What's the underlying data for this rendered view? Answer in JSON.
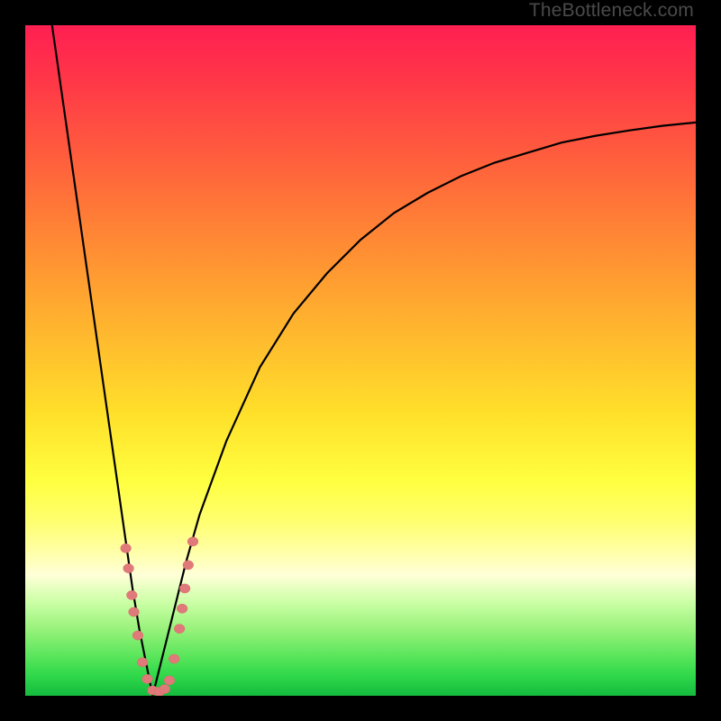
{
  "watermark": "TheBottleneck.com",
  "colors": {
    "frame": "#000000",
    "curve": "#000000",
    "dot_fill": "#e07a7a",
    "dot_stroke": "#d86a6a"
  },
  "chart_data": {
    "type": "line",
    "title": "",
    "xlabel": "",
    "ylabel": "",
    "xlim": [
      0,
      100
    ],
    "ylim": [
      0,
      100
    ],
    "note": "Background gradient encodes value: red=high, green=low. Two curves (left steep descent, right asymptotic rise) meeting at a notch near x≈19, y≈0. Pink dots mark sample points on both curve branches near the notch.",
    "series": [
      {
        "name": "left-branch",
        "x": [
          4,
          6,
          8,
          10,
          12,
          14,
          15,
          16,
          17,
          18,
          18.5,
          19
        ],
        "y": [
          100,
          86,
          72,
          58,
          44,
          30,
          23,
          16,
          10,
          5,
          2.5,
          0
        ]
      },
      {
        "name": "right-branch",
        "x": [
          19,
          20,
          22,
          24,
          26,
          30,
          35,
          40,
          45,
          50,
          55,
          60,
          65,
          70,
          75,
          80,
          85,
          90,
          95,
          100
        ],
        "y": [
          0,
          4,
          12,
          20,
          27,
          38,
          49,
          57,
          63,
          68,
          72,
          75,
          77.5,
          79.5,
          81,
          82.5,
          83.5,
          84.3,
          85,
          85.5
        ]
      }
    ],
    "dots": [
      {
        "x": 15.0,
        "y": 22.0,
        "r": 5.1
      },
      {
        "x": 15.4,
        "y": 19.0,
        "r": 5.1
      },
      {
        "x": 15.9,
        "y": 15.0,
        "r": 5.1
      },
      {
        "x": 16.2,
        "y": 12.5,
        "r": 5.1
      },
      {
        "x": 16.8,
        "y": 9.0,
        "r": 5.1
      },
      {
        "x": 17.5,
        "y": 5.0,
        "r": 5.1
      },
      {
        "x": 18.2,
        "y": 2.5,
        "r": 5.1
      },
      {
        "x": 19.0,
        "y": 0.8,
        "r": 5.1
      },
      {
        "x": 20.0,
        "y": 0.6,
        "r": 5.1
      },
      {
        "x": 20.8,
        "y": 1.0,
        "r": 5.1
      },
      {
        "x": 21.5,
        "y": 2.3,
        "r": 5.1
      },
      {
        "x": 22.2,
        "y": 5.5,
        "r": 5.1
      },
      {
        "x": 23.0,
        "y": 10.0,
        "r": 5.1
      },
      {
        "x": 23.4,
        "y": 13.0,
        "r": 5.1
      },
      {
        "x": 23.8,
        "y": 16.0,
        "r": 5.1
      },
      {
        "x": 24.3,
        "y": 19.5,
        "r": 5.1
      },
      {
        "x": 25.0,
        "y": 23.0,
        "r": 5.1
      }
    ]
  }
}
